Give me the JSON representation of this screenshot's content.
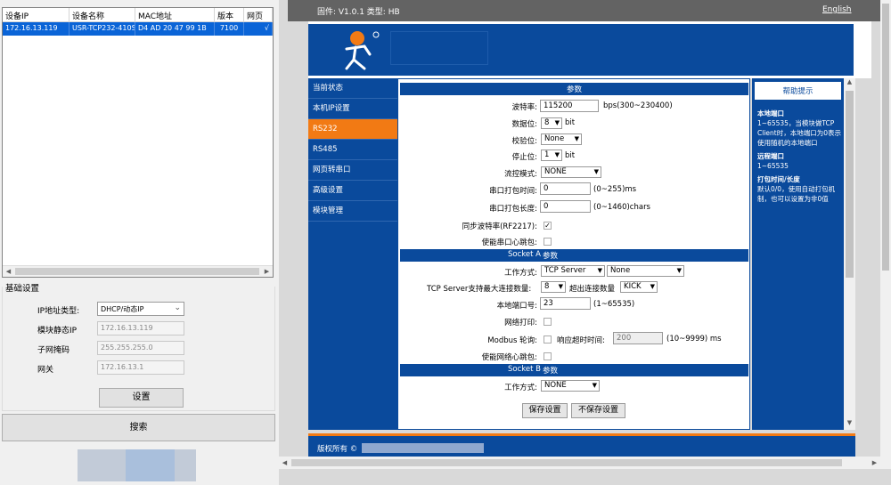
{
  "device_table": {
    "headers": [
      "设备IP",
      "设备名称",
      "MAC地址",
      "版本",
      "网页"
    ],
    "rows": [
      {
        "ip": "172.16.13.119",
        "name": "USR-TCP232-410S",
        "mac": "D4 AD 20 47 99 1B",
        "version": "7100",
        "web": "√"
      }
    ]
  },
  "basic": {
    "title": "基础设置",
    "ip_type_label": "IP地址类型:",
    "ip_type_value": "DHCP/动态IP",
    "static_ip_label": "模块静态IP",
    "static_ip_value": "172.16.13.119",
    "mask_label": "子网掩码",
    "mask_value": "255.255.255.0",
    "gateway_label": "网关",
    "gateway_value": "172.16.13.1",
    "set_button": "设置",
    "search_button": "搜索"
  },
  "web": {
    "firmware": "固件: V1.0.1 类型: HB",
    "english": "English",
    "nav": [
      "当前状态",
      "本机IP设置",
      "RS232",
      "RS485",
      "网页转串口",
      "高级设置",
      "模块管理"
    ],
    "params_title": "参数",
    "baud_label": "波特率:",
    "baud_value": "115200",
    "baud_unit": "bps(300~230400)",
    "databits_label": "数据位:",
    "databits_value": "8",
    "bit_unit": "bit",
    "parity_label": "校验位:",
    "parity_value": "None",
    "stopbits_label": "停止位:",
    "stopbits_value": "1",
    "flow_label": "流控模式:",
    "flow_value": "NONE",
    "pack_time_label": "串口打包时间:",
    "pack_time_value": "0",
    "pack_time_range": "(0~255)ms",
    "pack_len_label": "串口打包长度:",
    "pack_len_value": "0",
    "pack_len_range": "(0~1460)chars",
    "sync_label": "同步波特率(RF2217):",
    "heartbeat_label": "使能串口心跳包:",
    "socket_a": "Socket A",
    "socket_b": "Socket B",
    "param_word": "参数",
    "work_mode_label": "工作方式:",
    "work_mode_value": "TCP Server",
    "work_mode_value2": "None",
    "max_conn_label": "TCP Server支持最大连接数量:",
    "max_conn_value": "8",
    "exceed_label": "超出连接数量",
    "exceed_value": "KICK",
    "local_port_label": "本地端口号:",
    "local_port_value": "23",
    "local_port_range": "(1~65535)",
    "net_print_label": "网络打印:",
    "modbus_label": "Modbus 轮询:",
    "resp_timeout_label": "响应超时时间:",
    "resp_timeout_value": "200",
    "resp_timeout_range": "(10~9999) ms",
    "net_heartbeat_label": "使能网络心跳包:",
    "work_mode_b_value": "NONE",
    "save_button": "保存设置",
    "nosave_button": "不保存设置",
    "help_title": "帮助提示",
    "help": [
      {
        "title": "本地端口",
        "body": "1~65535，当模块做TCP Client时，本地端口为0表示使用随机的本地端口"
      },
      {
        "title": "远程端口",
        "body": "1~65535"
      },
      {
        "title": "打包时间/长度",
        "body": "默认0/0，使用自动打包机制，也可以设置为非0值"
      }
    ],
    "copyright": "版权所有 ©"
  },
  "colors": {
    "nav_blue": "#0a4a9c",
    "accent_orange": "#f27a14",
    "selection_blue": "#0a64d7"
  }
}
